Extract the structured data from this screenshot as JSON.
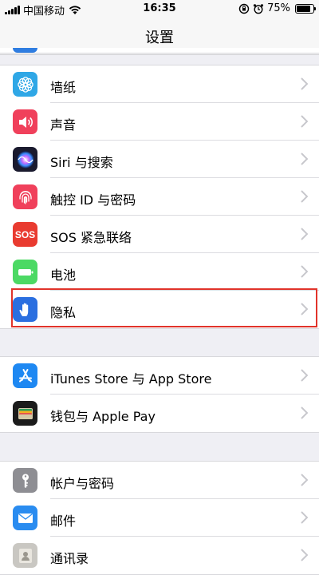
{
  "status_bar": {
    "carrier": "中国移动",
    "time": "16:35",
    "battery_percent": "75%",
    "battery_level": 0.75
  },
  "nav": {
    "title": "设置"
  },
  "groups": [
    {
      "rows": [
        {
          "label": "墙纸",
          "icon": "wallpaper-icon",
          "color": "#2fa7e6"
        },
        {
          "label": "声音",
          "icon": "speaker-icon",
          "color": "#f0405b"
        },
        {
          "label": "Siri 与搜索",
          "icon": "siri-icon",
          "color": "#1a1a2e"
        },
        {
          "label": "触控 ID 与密码",
          "icon": "fingerprint-icon",
          "color": "#f0405b"
        },
        {
          "label": "SOS 紧急联络",
          "icon": "sos-icon",
          "color": "#e93b30"
        },
        {
          "label": "电池",
          "icon": "battery-icon",
          "color": "#4cd964"
        },
        {
          "label": "隐私",
          "icon": "hand-icon",
          "color": "#2b6fe0"
        }
      ]
    },
    {
      "rows": [
        {
          "label": "iTunes Store 与 App Store",
          "icon": "app-store-icon",
          "color": "#1e88f2"
        },
        {
          "label": "钱包与 Apple Pay",
          "icon": "wallet-icon",
          "color": "#1b1b1b"
        }
      ]
    },
    {
      "rows": [
        {
          "label": "帐户与密码",
          "icon": "key-icon",
          "color": "#8e8e93"
        },
        {
          "label": "邮件",
          "icon": "mail-icon",
          "color": "#2a8cf0"
        },
        {
          "label": "通讯录",
          "icon": "contacts-icon",
          "color": "#c9c7c2"
        }
      ]
    }
  ],
  "icon_glyphs": {
    "sos": "SOS"
  }
}
